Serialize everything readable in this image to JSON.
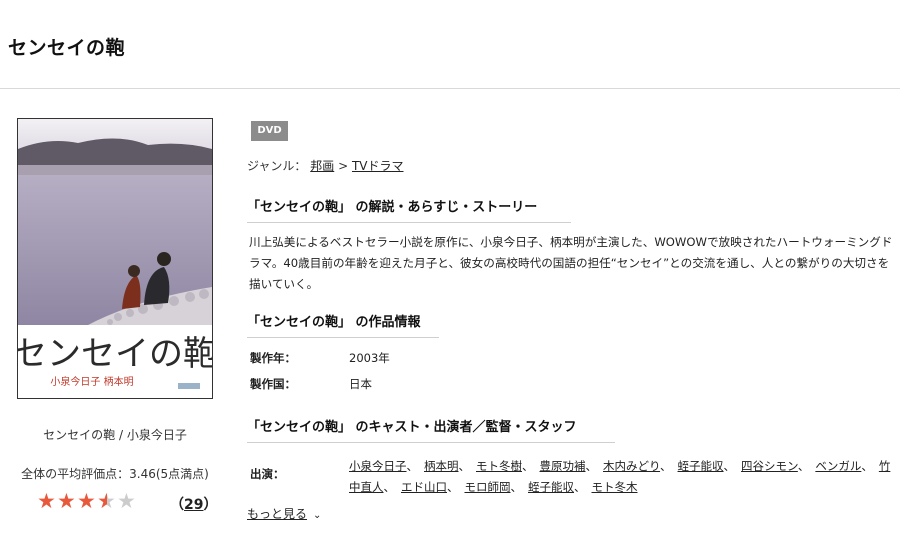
{
  "page": {
    "title": "センセイの鞄"
  },
  "poster": {
    "title_text": "センセイの鞄",
    "cast_text": "小泉今日子 柄本明",
    "caption": "センセイの鞄 / 小泉今日子"
  },
  "rating": {
    "average_label": "全体の平均評価点：3.46(5点満点)",
    "score": 3.46,
    "max": 5,
    "count_open": "（",
    "count": "29",
    "count_close": "）",
    "star_color": "#e8593b",
    "star_empty_color": "#cccccc"
  },
  "badge": {
    "label": "DVD",
    "color": "#8c8c8c"
  },
  "genre": {
    "label": "ジャンル：",
    "items": [
      "邦画",
      "TVドラマ"
    ],
    "separator": ">"
  },
  "sections": {
    "story_heading": "「センセイの鞄」 の解説・あらすじ・ストーリー",
    "info_heading": "「センセイの鞄」 の作品情報",
    "cast_heading": "「センセイの鞄」 のキャスト・出演者／監督・スタッフ"
  },
  "description": "川上弘美によるベストセラー小説を原作に、小泉今日子、柄本明が主演した、WOWOWで放映されたハートウォーミングドラマ。40歳目前の年齢を迎えた月子と、彼女の高校時代の国語の担任“センセイ”との交流を通し、人との繋がりの大切さを描いていく。",
  "info": {
    "year_label": "製作年：",
    "year": "2003年",
    "country_label": "製作国：",
    "country": "日本"
  },
  "cast": {
    "label": "出演：",
    "members": [
      "小泉今日子",
      "柄本明",
      "モト冬樹",
      "豊原功補",
      "木内みどり",
      "蛭子能収",
      "四谷シモン",
      "ベンガル",
      "竹中直人",
      "エド山口",
      "モロ師岡",
      "蛭子能収",
      "モト冬木"
    ],
    "separator": "、"
  },
  "more": {
    "label": "もっと見る",
    "icon": "chevron-down-icon"
  }
}
